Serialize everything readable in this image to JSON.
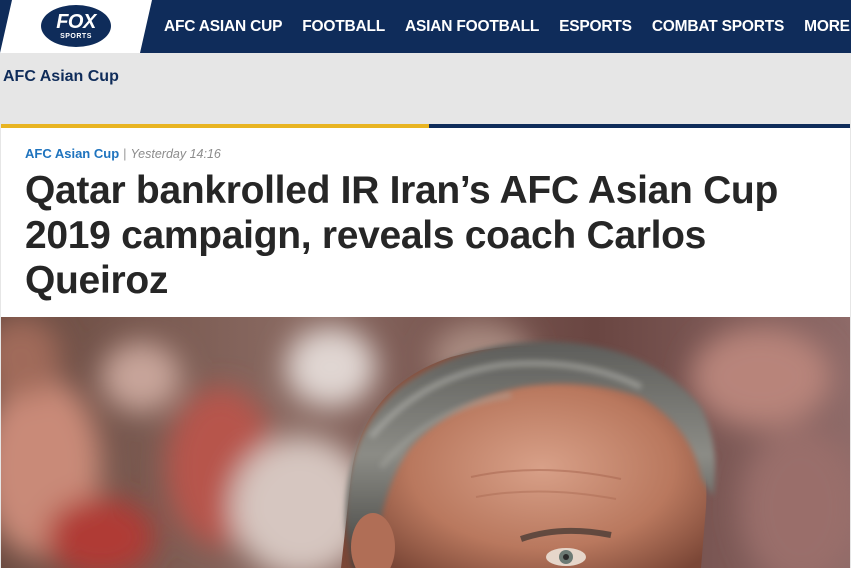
{
  "header": {
    "logo": {
      "line1": "FOX",
      "line2": "SPORTS"
    },
    "nav": [
      {
        "label": "AFC ASIAN CUP"
      },
      {
        "label": "FOOTBALL"
      },
      {
        "label": "ASIAN FOOTBALL"
      },
      {
        "label": "ESPORTS"
      },
      {
        "label": "COMBAT SPORTS"
      },
      {
        "label": "MORE"
      }
    ]
  },
  "section": {
    "title": "AFC Asian Cup"
  },
  "article": {
    "category": "AFC Asian Cup",
    "separator": "|",
    "timestamp": "Yesterday 14:16",
    "headline": "Qatar bankrolled IR Iran’s AFC Asian Cup 2019 campaign, reveals coach Carlos Queiroz"
  },
  "colors": {
    "navy": "#0f2c5a",
    "gold": "#e8b422",
    "link_blue": "#1e73be",
    "headline": "#262626"
  }
}
